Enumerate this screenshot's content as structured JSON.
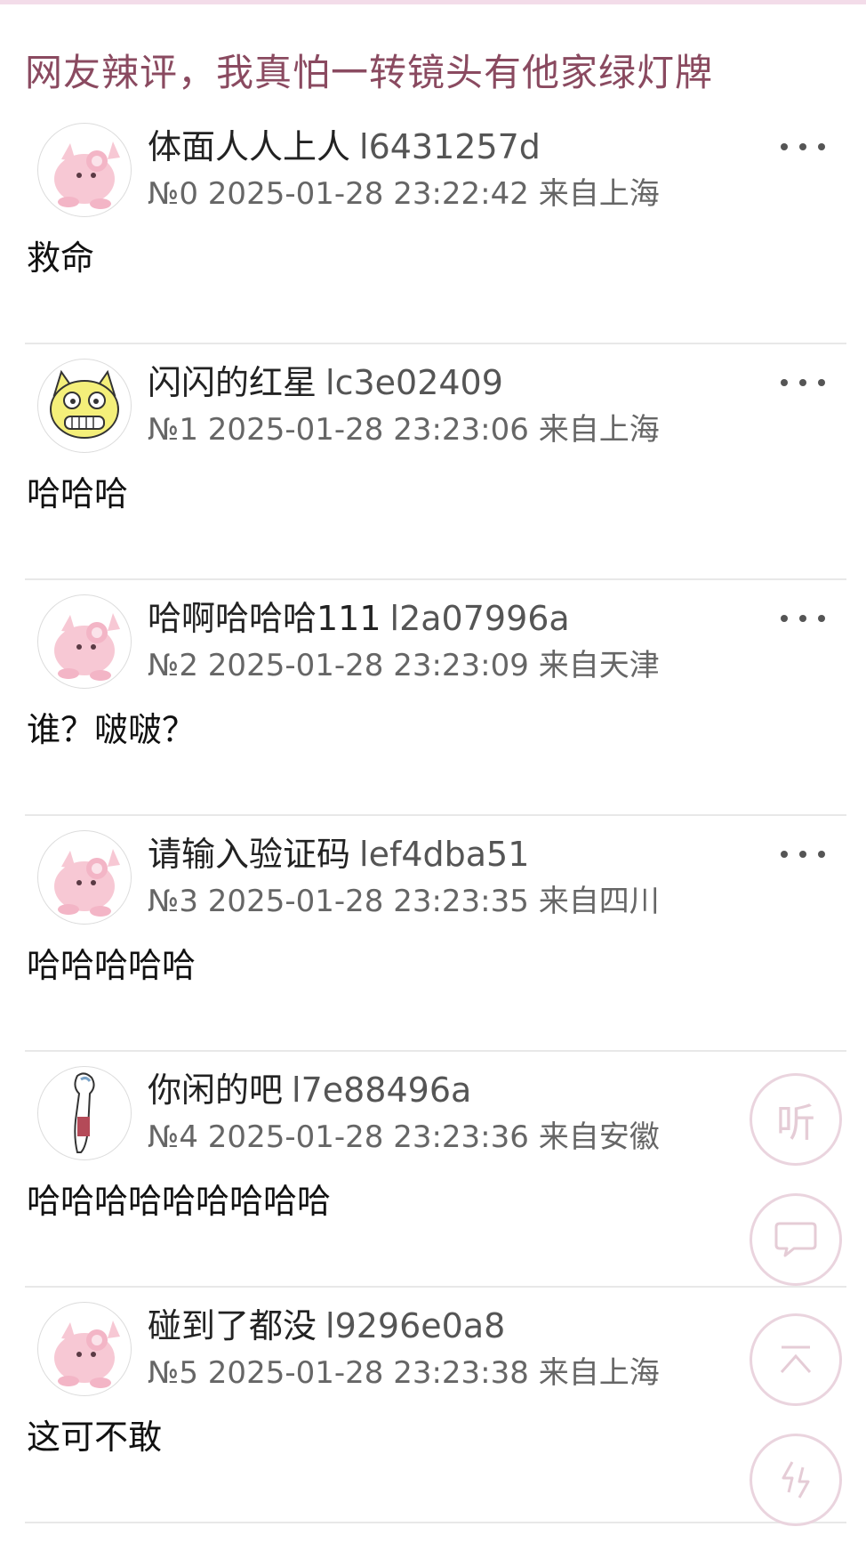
{
  "title": "网友辣评，我真怕一转镜头有他家绿灯牌",
  "posts": [
    {
      "name": "体面人人上人",
      "uid": "l6431257d",
      "meta": "№0 2025-01-28 23:22:42 来自上海",
      "content": "救命",
      "avatar": "pink-puffball-avatar"
    },
    {
      "name": "闪闪的红星",
      "uid": "lc3e02409",
      "meta": "№1 2025-01-28 23:23:06 来自上海",
      "content": "哈哈哈",
      "avatar": "yellow-cat-avatar"
    },
    {
      "name": "哈啊哈哈哈111",
      "uid": "l2a07996a",
      "meta": "№2 2025-01-28 23:23:09 来自天津",
      "content": "谁？啵啵？",
      "avatar": "pink-puffball-avatar"
    },
    {
      "name": "请输入验证码",
      "uid": "lef4dba51",
      "meta": "№3 2025-01-28 23:23:35 来自四川",
      "content": "哈哈哈哈哈",
      "avatar": "pink-puffball-avatar"
    },
    {
      "name": "你闲的吧",
      "uid": "l7e88496a",
      "meta": "№4 2025-01-28 23:23:36 来自安徽",
      "content": "哈哈哈哈哈哈哈哈哈",
      "avatar": "sketch-figure-avatar"
    },
    {
      "name": "碰到了都没",
      "uid": "l9296e0a8",
      "meta": "№5 2025-01-28 23:23:38 来自上海",
      "content": "这可不敢",
      "avatar": "pink-puffball-avatar"
    }
  ],
  "fab": {
    "listen_label": "听",
    "icons": [
      "comment-icon",
      "scroll-to-top-icon",
      "refresh-swap-icon"
    ]
  },
  "colors": {
    "title": "#8a4a60",
    "accent_border": "#ead4de",
    "divider": "#e8e8e8"
  }
}
